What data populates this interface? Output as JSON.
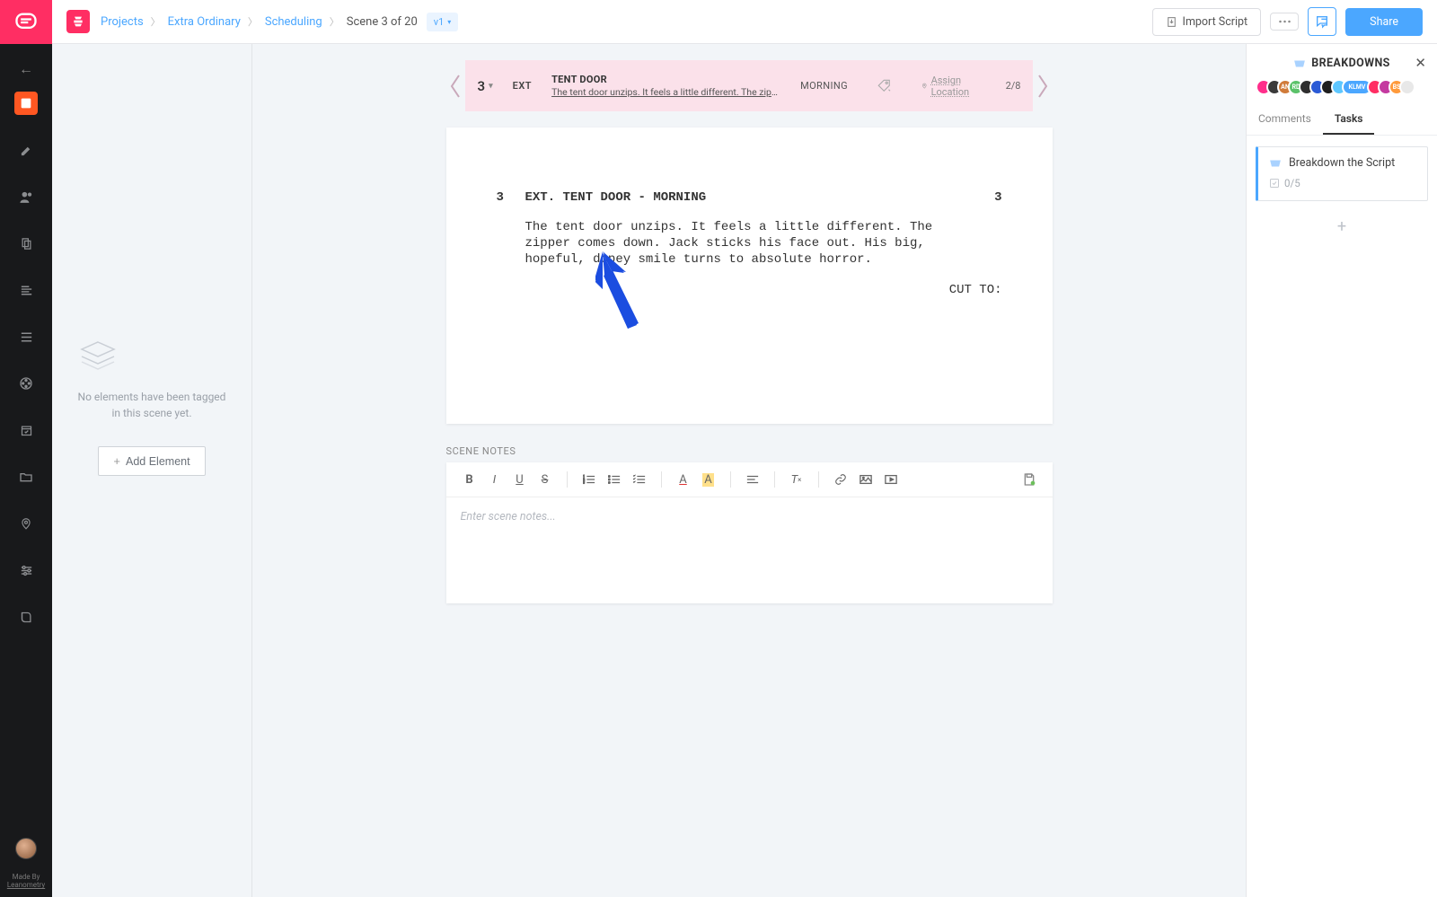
{
  "sidebar": {
    "credit": {
      "line1": "Made By",
      "line2": "Leanometry"
    }
  },
  "topbar": {
    "breadcrumbs": [
      "Projects",
      "Extra Ordinary",
      "Scheduling",
      "Scene 3 of 20"
    ],
    "version": "v1",
    "import_label": "Import Script",
    "share_label": "Share"
  },
  "elements_panel": {
    "empty_line1": "No elements have been tagged",
    "empty_line2": "in this scene yet.",
    "add_label": "Add Element"
  },
  "scene_header": {
    "number": "3",
    "ext": "EXT",
    "title": "TENT DOOR",
    "logline": "The tent door unzips. It feels a little different. The zipper com...",
    "time": "MORNING",
    "assign_location": "Assign Location",
    "page": "2/8"
  },
  "script": {
    "left_num": "3",
    "slug": "EXT. TENT DOOR - MORNING",
    "right_num": "3",
    "action": "The tent door unzips. It feels a little different. The zipper comes down. Jack sticks his face out. His big, hopeful, dopey smile turns to absolute horror.",
    "transition": "CUT TO:"
  },
  "notes": {
    "section_label": "SCENE NOTES",
    "placeholder": "Enter scene notes..."
  },
  "breakdown": {
    "title": "BREAKDOWNS",
    "tabs": {
      "comments": "Comments",
      "tasks": "Tasks"
    },
    "task": {
      "title": "Breakdown the Script",
      "progress": "0/5"
    },
    "avatars": [
      {
        "bg": "#ff2e8b",
        "tx": ""
      },
      {
        "bg": "#3a3a3a",
        "tx": ""
      },
      {
        "bg": "#d07b3a",
        "tx": "AN"
      },
      {
        "bg": "#5bc26a",
        "tx": "RD"
      },
      {
        "bg": "#2f2f2f",
        "tx": ""
      },
      {
        "bg": "#2a5ad6",
        "tx": ""
      },
      {
        "bg": "#1f1f1f",
        "tx": ""
      },
      {
        "bg": "#5ec7ff",
        "tx": ""
      },
      {
        "bg": "#4ba7ff",
        "tx": "KLMV"
      },
      {
        "bg": "#ff2e63",
        "tx": ""
      },
      {
        "bg": "#c43aa0",
        "tx": ""
      },
      {
        "bg": "#ff9a3a",
        "tx": "BS"
      },
      {
        "bg": "#e8e8e8",
        "tx": ""
      }
    ]
  }
}
